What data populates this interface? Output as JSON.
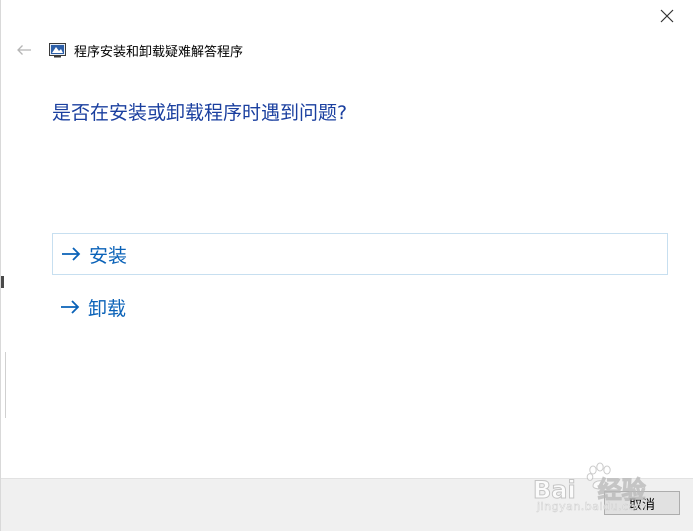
{
  "window": {
    "title": "程序安装和卸载疑难解答程序",
    "close_icon": "close-icon",
    "back_icon": "back-arrow-icon",
    "app_icon": "troubleshooter-icon"
  },
  "main": {
    "question": "是否在安装或卸载程序时遇到问题?",
    "options": [
      {
        "label": "安装",
        "icon": "arrow-right-icon",
        "selected": true
      },
      {
        "label": "卸载",
        "icon": "arrow-right-icon",
        "selected": false
      }
    ]
  },
  "footer": {
    "cancel_label": "取消"
  },
  "watermark": {
    "brand": "Bai",
    "brand_tail": "经验",
    "url": "jingyan.baidu.com"
  },
  "colors": {
    "heading": "#1a3f9f",
    "option_text": "#0a62b8",
    "selected_border": "#c7dff0",
    "footer_bg": "#f0f0f0"
  }
}
